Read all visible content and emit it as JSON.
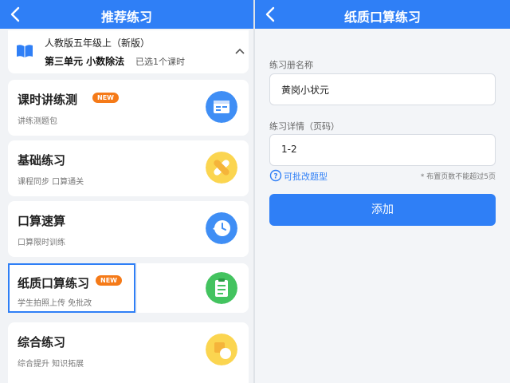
{
  "left": {
    "nav_title": "推荐练习",
    "course": {
      "textbook": "人教版五年级上（新版）",
      "unit": "第三单元 小数除法",
      "selected": "已选1个课时"
    },
    "cards": [
      {
        "name": "课时讲练测",
        "desc": "讲练测题包",
        "badge": "NEW"
      },
      {
        "name": "基础练习",
        "desc": "课程同步 口算通关"
      },
      {
        "name": "口算速算",
        "desc": "口算限时训练"
      },
      {
        "name": "纸质口算练习",
        "desc": "学生拍照上传 免批改",
        "badge": "NEW"
      },
      {
        "name": "综合练习",
        "desc": "综合提升 知识拓展"
      }
    ]
  },
  "right": {
    "nav_title": "纸质口算练习",
    "book_label": "练习册名称",
    "book_value": "黄岗小状元",
    "detail_label": "练习详情（页码）",
    "detail_value": "1-2",
    "tip_text": "可批改题型",
    "note": "* 布置页数不能超过5页",
    "add_label": "添加"
  },
  "colors": {
    "accent": "#2f7ff6",
    "badge": "#f57a18"
  }
}
